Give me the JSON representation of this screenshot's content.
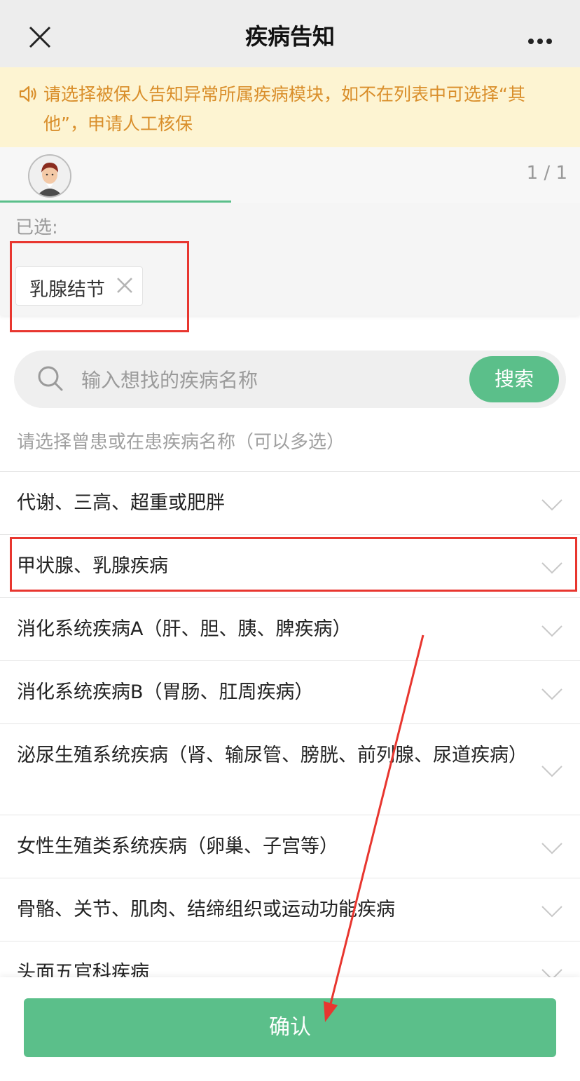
{
  "header": {
    "title": "疾病告知",
    "close_icon": "close-icon",
    "more_icon": "more-dots-icon"
  },
  "notice": {
    "icon": "speaker-icon",
    "text": "请选择被保人告知异常所属疾病模块，如不在列表中可选择“其他”，申请人工核保",
    "color": "#d98e2a"
  },
  "person_tabs": {
    "page_indicator": "1 / 1"
  },
  "selected": {
    "label": "已选:",
    "chips": [
      {
        "label": "乳腺结节"
      }
    ]
  },
  "search": {
    "placeholder": "输入想找的疾病名称",
    "button_label": "搜索"
  },
  "hint": "请选择曾患或在患疾病名称（可以多选）",
  "categories": [
    {
      "label": "代谢、三高、超重或肥胖"
    },
    {
      "label": "甲状腺、乳腺疾病"
    },
    {
      "label": "消化系统疾病A（肝、胆、胰、脾疾病）"
    },
    {
      "label": "消化系统疾病B（胃肠、肛周疾病）"
    },
    {
      "label": "泌尿生殖系统疾病（肾、输尿管、膀胱、前列腺、尿道疾病）"
    },
    {
      "label": "女性生殖类系统疾病（卵巢、子宫等）"
    },
    {
      "label": "骨骼、关节、肌肉、结缔组织或运动功能疾病"
    },
    {
      "label": "头面五官科疾病"
    }
  ],
  "footer": {
    "confirm_label": "确认"
  },
  "colors": {
    "accent": "#5bbf8a",
    "annotation": "#e8362f"
  }
}
